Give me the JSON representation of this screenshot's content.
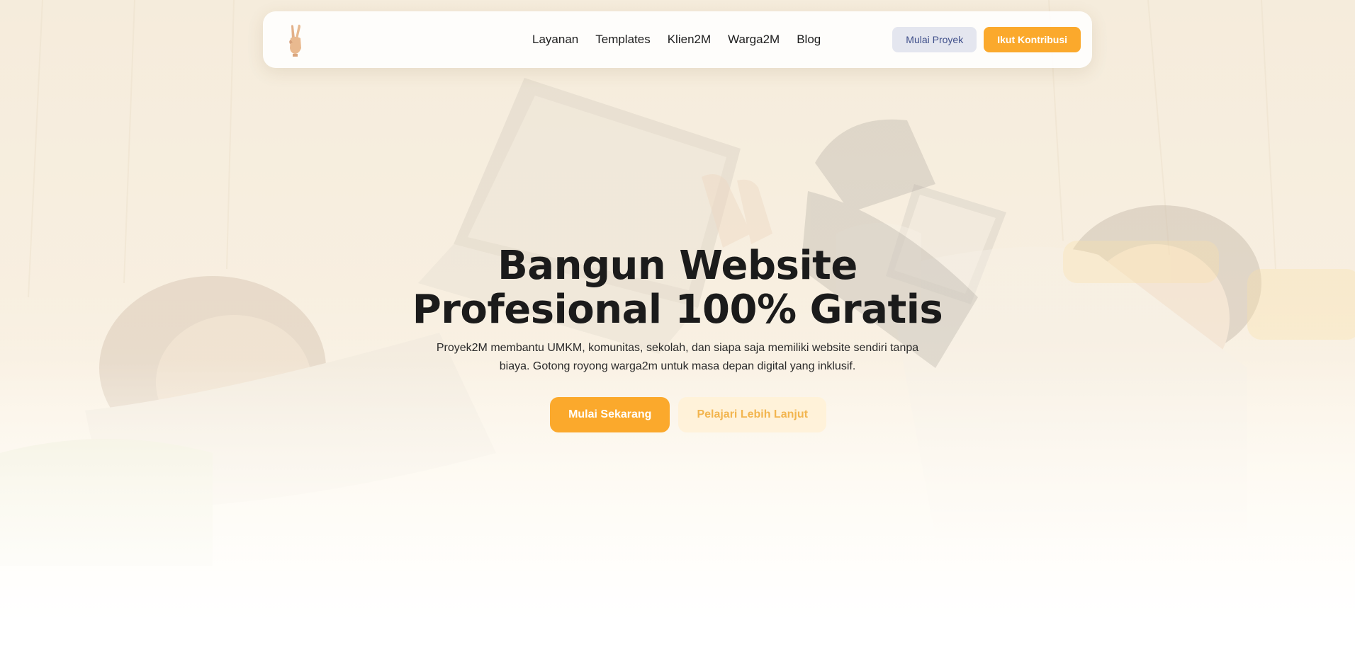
{
  "nav": {
    "logo": "peace-hand-icon",
    "links": [
      "Layanan",
      "Templates",
      "Klien2M",
      "Warga2M",
      "Blog"
    ],
    "secondary_cta": "Mulai Proyek",
    "primary_cta": "Ikut Kontribusi"
  },
  "hero": {
    "title_line1": "Bangun Website",
    "title_line2": "Profesional 100% Gratis",
    "description": "Proyek2M membantu UMKM, komunitas, sekolah, dan siapa saja memiliki website sendiri tanpa biaya. Gotong royong warga2m untuk masa depan digital yang inklusif.",
    "primary_button": "Mulai Sekarang",
    "secondary_button": "Pelajari Lebih Lanjut"
  },
  "colors": {
    "accent": "#fba92c",
    "secondary_button_bg": "#e4e6ef",
    "secondary_button_text": "#3f4f8a"
  }
}
